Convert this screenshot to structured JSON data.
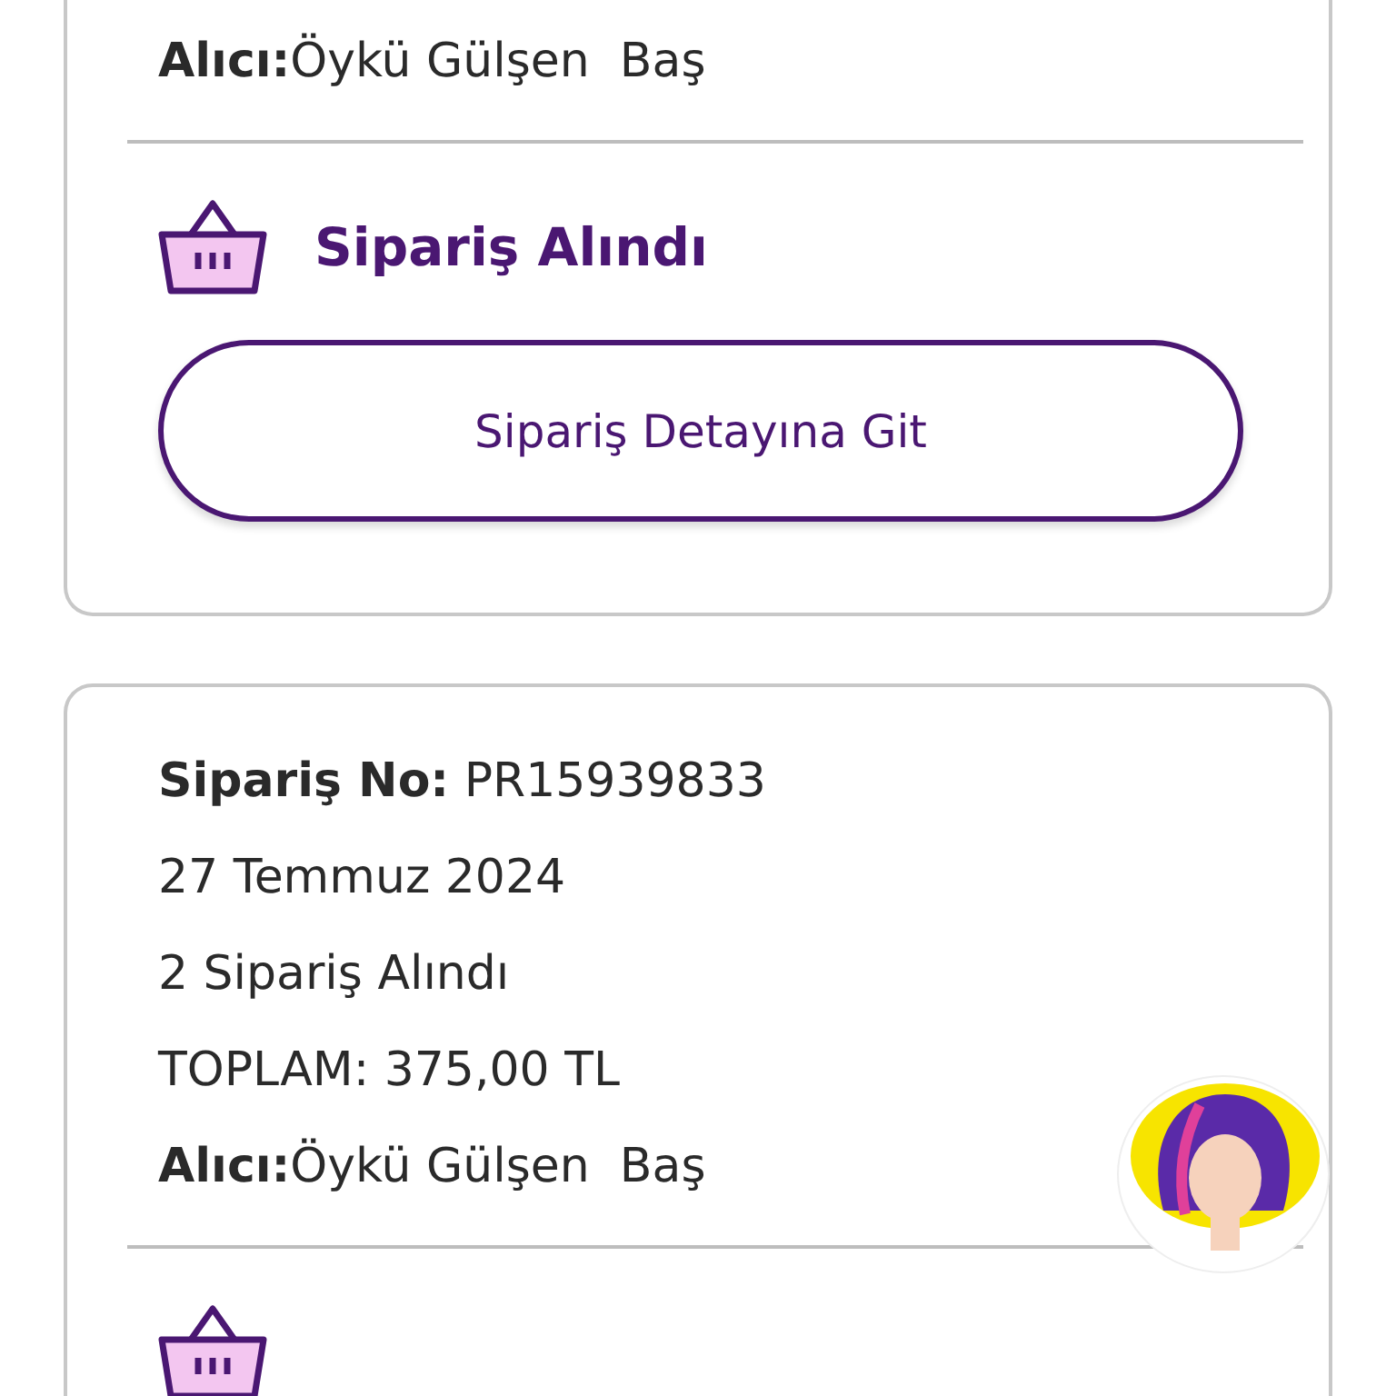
{
  "orders": [
    {
      "lines": [
        "**Alıcı:**Öykü Gülşen  Baş"
      ],
      "status": "Sipariş Alındı",
      "button": "Sipariş Detayına Git"
    },
    {
      "lines": [
        "**Sipariş No:** PR15939833",
        "27 Temmuz 2024",
        "2 Sipariş Alındı",
        "TOPLAM: 375,00 TL",
        "**Alıcı:**Öykü Gülşen  Baş"
      ]
    }
  ]
}
